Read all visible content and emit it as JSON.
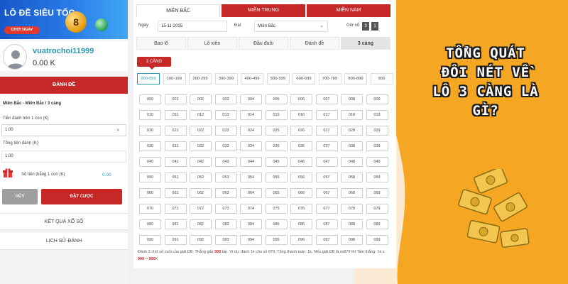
{
  "banner": {
    "title": "LÔ ĐỀ SIÊU TỐC",
    "button": "CHƠI NGAY",
    "ball_number": "8"
  },
  "user": {
    "name": "vuatrochoi11999",
    "balance": "0.00 K"
  },
  "bet_panel": {
    "header": "ĐÁNH ĐỀ",
    "region_path": "Miền Bắc - Miền Bắc / 3 càng",
    "per_unit_label": "Tiền đánh trên 1 con (K)",
    "per_unit_value": "1.00",
    "clear_symbol": "×",
    "total_label": "Tổng tiền đánh (K)",
    "total_value": "1.00",
    "win_label": "Số tiền thắng 1 con (K)",
    "win_value": "0.00",
    "cancel_label": "HỦY",
    "place_label": "ĐẶT CƯỢC"
  },
  "links": {
    "results": "KẾT QUẢ XỔ SỐ",
    "history": "LỊCH SỬ ĐÁNH"
  },
  "region_tabs": [
    "MIỀN BẮC",
    "MIỀN TRUNG",
    "MIỀN NAM"
  ],
  "filters": {
    "date_label": "Ngày",
    "date_value": "15-11-2025",
    "station_label": "Đài",
    "station_value": "Miền Bắc",
    "station_chevron": "⌄",
    "draw_label": "Giờ xổ",
    "draw_values": [
      "3",
      "1"
    ]
  },
  "bet_type_tabs": [
    "Bao lô",
    "Lô xiên",
    "Đầu đuôi",
    "Đánh đề",
    "3 càng"
  ],
  "sub_type": "3 CÀNG",
  "ranges": [
    "000-099",
    "100-199",
    "200-299",
    "300-399",
    "400-499",
    "500-599",
    "600-699",
    "700-799",
    "800-899",
    "900"
  ],
  "numbers": [
    "000",
    "001",
    "002",
    "003",
    "004",
    "005",
    "006",
    "007",
    "008",
    "009",
    "010",
    "011",
    "012",
    "013",
    "014",
    "015",
    "016",
    "017",
    "018",
    "019",
    "020",
    "021",
    "022",
    "023",
    "024",
    "025",
    "026",
    "027",
    "028",
    "029",
    "030",
    "031",
    "032",
    "033",
    "034",
    "035",
    "036",
    "037",
    "038",
    "039",
    "040",
    "041",
    "042",
    "043",
    "044",
    "045",
    "046",
    "047",
    "048",
    "049",
    "050",
    "051",
    "052",
    "053",
    "054",
    "055",
    "056",
    "057",
    "058",
    "059",
    "060",
    "061",
    "062",
    "063",
    "064",
    "065",
    "066",
    "067",
    "068",
    "069",
    "070",
    "071",
    "072",
    "073",
    "074",
    "075",
    "076",
    "077",
    "078",
    "079",
    "080",
    "081",
    "082",
    "083",
    "084",
    "085",
    "086",
    "087",
    "088",
    "089",
    "090",
    "091",
    "092",
    "093",
    "094",
    "095",
    "096",
    "097",
    "098",
    "099"
  ],
  "note": {
    "part1": "Đánh 3 chữ số cuối của giải ĐB. Thắng gấp ",
    "highlight1": "900",
    "part2": " lần. Ví dụ: đánh 1k cho số 879, Tổng thanh toán: 1k. Nếu giải ĐB là xx879 thì Tiền thắng: 1k x ",
    "highlight2": "900",
    "part3": " = ",
    "highlight3": "900",
    "part4": "K"
  },
  "promo": {
    "lines": [
      "TỔNG QUÁT",
      "ĐÔI NÉT VỀ",
      "LÔ 3 CÀNG LÀ",
      "GÌ?"
    ]
  },
  "colors": {
    "primary_red": "#c62828",
    "accent_teal": "#2b9bb5",
    "promo_orange": "#f5a623",
    "promo_bg": "#fbe9d3"
  }
}
